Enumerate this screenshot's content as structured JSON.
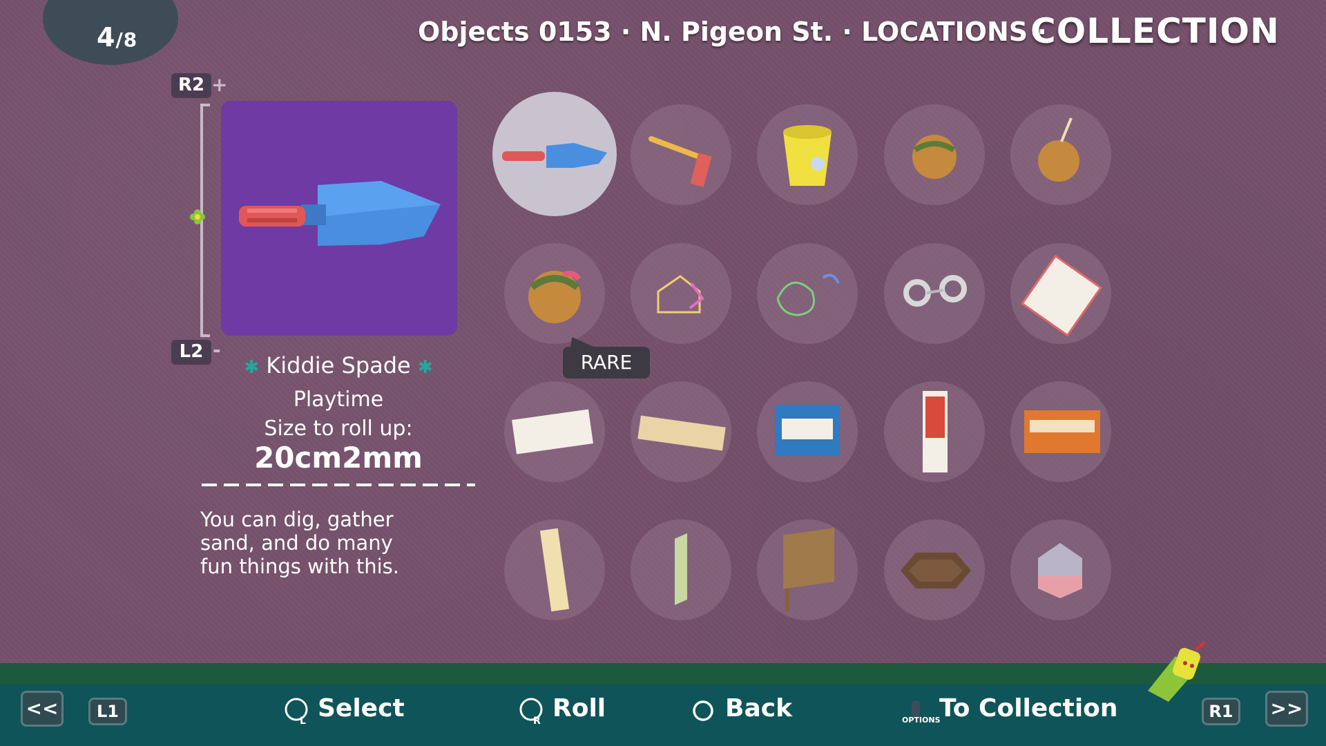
{
  "header": {
    "page_current": "4",
    "page_separator": "/",
    "page_total": "8",
    "breadcrumb": "Objects 0153 · N. Pigeon St. · LOCATIONS ·",
    "title": "COLLECTION"
  },
  "zoom": {
    "in_button": "R2",
    "in_sign": "+",
    "out_button": "L2",
    "out_sign": "-"
  },
  "selected_item": {
    "name": "Kiddie Spade",
    "category": "Playtime",
    "size_label": "Size to roll up:",
    "size_value": "20cm2mm",
    "description": "You can dig, gather sand, and do many fun things with this."
  },
  "tooltip": {
    "label": "RARE"
  },
  "grid_items": [
    {
      "icon": "kiddie-spade-icon"
    },
    {
      "icon": "toy-rake-icon"
    },
    {
      "icon": "sand-bucket-icon"
    },
    {
      "icon": "takoyaki-icon"
    },
    {
      "icon": "takoyaki-on-stick-icon"
    },
    {
      "icon": "rare-takoyaki-icon"
    },
    {
      "icon": "chalk-house-drawing-icon"
    },
    {
      "icon": "chalk-dinosaur-drawing-icon"
    },
    {
      "icon": "handcuffs-icon"
    },
    {
      "icon": "postcard-icon"
    },
    {
      "icon": "paper-note-icon"
    },
    {
      "icon": "paper-strip-icon"
    },
    {
      "icon": "pump-sign-icon"
    },
    {
      "icon": "fire-safety-sign-icon"
    },
    {
      "icon": "electronics-sign-icon"
    },
    {
      "icon": "poster-strip-icon"
    },
    {
      "icon": "wooden-post-icon"
    },
    {
      "icon": "wooden-fence-icon"
    },
    {
      "icon": "manhole-cover-icon"
    },
    {
      "icon": "rice-ball-icon"
    }
  ],
  "footer": {
    "prev": "<<",
    "l1": "L1",
    "select": "Select",
    "roll": "Roll",
    "back": "Back",
    "options_label": "OPTIONS",
    "to_collection": "To Collection",
    "r1": "R1",
    "next": ">>"
  },
  "colors": {
    "background": "#75506b",
    "preview_bg": "#6f3aa3",
    "footer": "#0f5458",
    "accent_star": "#2aa59b"
  }
}
